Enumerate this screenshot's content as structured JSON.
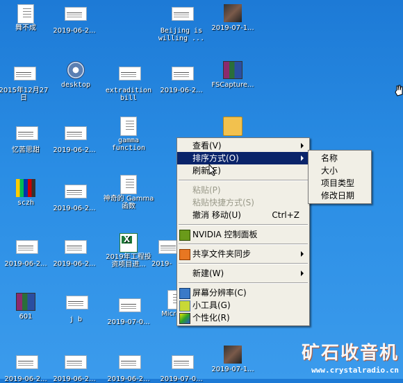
{
  "desktop_icons": [
    {
      "label": "舞不成",
      "icon": "doc-icon"
    },
    {
      "label": "2019-06-2...",
      "icon": "image-thumb-icon"
    },
    {
      "label": "Beijing is willing ...",
      "icon": "image-thumb-icon"
    },
    {
      "label": "2019-07-1...",
      "icon": "photo-icon"
    },
    {
      "label": "2015年12月27日",
      "icon": "image-thumb-icon"
    },
    {
      "label": "desktop",
      "icon": "settings-gear-icon"
    },
    {
      "label": "extradition bill",
      "icon": "image-thumb-icon"
    },
    {
      "label": "2019-06-2...",
      "icon": "image-thumb-icon"
    },
    {
      "label": "FSCapture...",
      "icon": "winrar-archive-icon"
    },
    {
      "label": "忆苦思甜",
      "icon": "image-thumb-icon"
    },
    {
      "label": "2019-06-2...",
      "icon": "image-thumb-icon"
    },
    {
      "label": "gamma function",
      "icon": "doc-icon"
    },
    {
      "label": "sczh",
      "icon": "bars-app-icon"
    },
    {
      "label": "2019-06-2...",
      "icon": "image-thumb-icon"
    },
    {
      "label": "神奇的 Gamma 函数",
      "icon": "doc-icon"
    },
    {
      "label": "2019-06-2...",
      "icon": "image-thumb-icon"
    },
    {
      "label": "2019-06-2...",
      "icon": "image-thumb-icon"
    },
    {
      "label": "2019年工程投资项目进...",
      "icon": "excel-icon"
    },
    {
      "label": "601",
      "icon": "winrar-archive-icon"
    },
    {
      "label": "j b",
      "icon": "image-thumb-icon"
    },
    {
      "label": "2019-07-0...",
      "icon": "image-thumb-icon"
    },
    {
      "label": "2019-06-2...",
      "icon": "image-thumb-icon"
    },
    {
      "label": "2019-06-2...",
      "icon": "image-thumb-icon"
    },
    {
      "label": "2019-06-2...",
      "icon": "image-thumb-icon"
    },
    {
      "label": "2019-07-0...",
      "icon": "image-thumb-icon"
    },
    {
      "label": "2019-07-1...",
      "icon": "photo-icon"
    }
  ],
  "partial_labels": {
    "a": "2019-",
    "b": "Micros..."
  },
  "context_menu": {
    "items": [
      {
        "label": "查看(V)",
        "submenu": true
      },
      {
        "label": "排序方式(O)",
        "submenu": true,
        "selected": true
      },
      {
        "label": "刷新(E)"
      },
      {
        "label": "粘贴(P)",
        "disabled": true
      },
      {
        "label": "粘贴快捷方式(S)",
        "disabled": true
      },
      {
        "label": "撤消 移动(U)",
        "shortcut": "Ctrl+Z"
      },
      {
        "label": "NVIDIA 控制面板",
        "icon": "nvidia-icon"
      },
      {
        "label": "共享文件夹同步",
        "submenu": true,
        "icon": "share-sync-icon"
      },
      {
        "label": "新建(W)",
        "submenu": true
      },
      {
        "label": "屏幕分辨率(C)",
        "icon": "screen-resolution-icon"
      },
      {
        "label": "小工具(G)",
        "icon": "gadgets-icon"
      },
      {
        "label": "个性化(R)",
        "icon": "personalize-icon"
      }
    ]
  },
  "sort_submenu": {
    "items": [
      "名称",
      "大小",
      "项目类型",
      "修改日期"
    ]
  },
  "watermark": {
    "title": "矿石收音机",
    "url": "www.crystalradio.cn"
  }
}
